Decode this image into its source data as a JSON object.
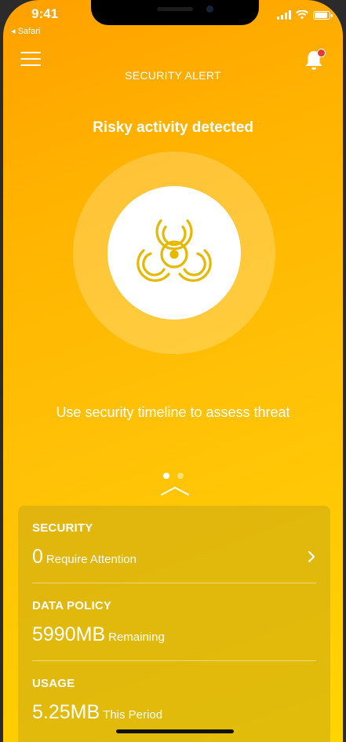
{
  "status_bar": {
    "time": "9:41",
    "back_app": "◂ Safari"
  },
  "header": {
    "title": "SECURITY ALERT",
    "menu_icon": "hamburger-menu-icon",
    "notification_icon": "bell-icon",
    "notification_badge_color": "#e53935"
  },
  "alert": {
    "title": "Risky activity detected",
    "icon": "biohazard-icon",
    "message": "Use security timeline to assess threat"
  },
  "pager": {
    "total": 2,
    "active": 1
  },
  "summary": {
    "security": {
      "label": "SECURITY",
      "value": "0",
      "unit": "Require Attention"
    },
    "data_policy": {
      "label": "DATA POLICY",
      "value": "5990MB",
      "unit": "Remaining"
    },
    "usage": {
      "label": "USAGE",
      "value": "5.25MB",
      "unit": "This Period"
    }
  },
  "colors": {
    "gradient_top": "#ffa000",
    "gradient_bottom": "#ffd400",
    "hazard_icon": "#e6b800"
  }
}
